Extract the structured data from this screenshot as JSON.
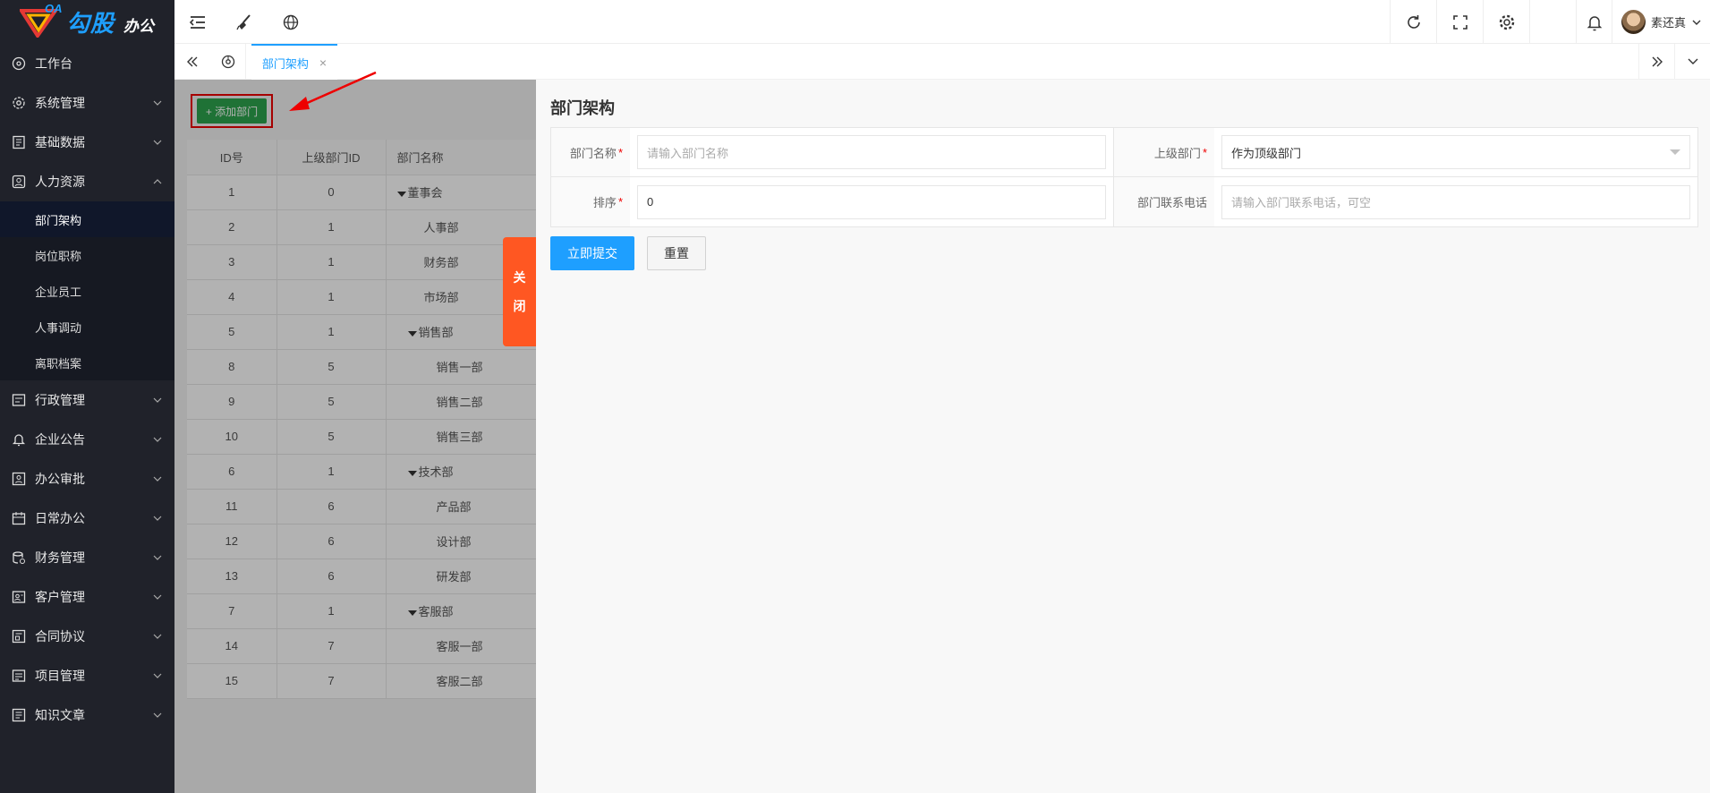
{
  "app": {
    "logo_oa": "OA",
    "logo_brand": "勾股",
    "logo_brand_sub": "办公"
  },
  "sidebar": {
    "items": [
      {
        "label": "工作台",
        "icon": "dashboard-icon"
      },
      {
        "label": "系统管理",
        "icon": "system-icon"
      },
      {
        "label": "基础数据",
        "icon": "data-icon"
      },
      {
        "label": "人力资源",
        "icon": "hr-icon"
      },
      {
        "label": "行政管理",
        "icon": "admin-icon"
      },
      {
        "label": "企业公告",
        "icon": "bell-icon"
      },
      {
        "label": "办公审批",
        "icon": "approve-icon"
      },
      {
        "label": "日常办公",
        "icon": "calendar-icon"
      },
      {
        "label": "财务管理",
        "icon": "finance-icon"
      },
      {
        "label": "客户管理",
        "icon": "customer-icon"
      },
      {
        "label": "合同协议",
        "icon": "contract-icon"
      },
      {
        "label": "项目管理",
        "icon": "project-icon"
      },
      {
        "label": "知识文章",
        "icon": "article-icon"
      }
    ],
    "hr_sub": [
      {
        "label": "部门架构"
      },
      {
        "label": "岗位职称"
      },
      {
        "label": "企业员工"
      },
      {
        "label": "人事调动"
      },
      {
        "label": "离职档案"
      }
    ]
  },
  "header": {
    "user_name": "素还真"
  },
  "tabs": {
    "active_label": "部门架构",
    "close": "×"
  },
  "page": {
    "add_button": "+ 添加部门",
    "table_headers": {
      "id": "ID号",
      "pid": "上级部门ID",
      "name": "部门名称"
    },
    "rows": [
      {
        "id": "1",
        "pid": "0",
        "name": "董事会",
        "level": 0,
        "tree": true
      },
      {
        "id": "2",
        "pid": "1",
        "name": "人事部",
        "level": 1,
        "tree": false
      },
      {
        "id": "3",
        "pid": "1",
        "name": "财务部",
        "level": 1,
        "tree": false
      },
      {
        "id": "4",
        "pid": "1",
        "name": "市场部",
        "level": 1,
        "tree": false
      },
      {
        "id": "5",
        "pid": "1",
        "name": "销售部",
        "level": 1,
        "tree": true
      },
      {
        "id": "8",
        "pid": "5",
        "name": "销售一部",
        "level": 2,
        "tree": false
      },
      {
        "id": "9",
        "pid": "5",
        "name": "销售二部",
        "level": 2,
        "tree": false
      },
      {
        "id": "10",
        "pid": "5",
        "name": "销售三部",
        "level": 2,
        "tree": false
      },
      {
        "id": "6",
        "pid": "1",
        "name": "技术部",
        "level": 1,
        "tree": true
      },
      {
        "id": "11",
        "pid": "6",
        "name": "产品部",
        "level": 2,
        "tree": false
      },
      {
        "id": "12",
        "pid": "6",
        "name": "设计部",
        "level": 2,
        "tree": false
      },
      {
        "id": "13",
        "pid": "6",
        "name": "研发部",
        "level": 2,
        "tree": false
      },
      {
        "id": "7",
        "pid": "1",
        "name": "客服部",
        "level": 1,
        "tree": true
      },
      {
        "id": "14",
        "pid": "7",
        "name": "客服一部",
        "level": 2,
        "tree": false
      },
      {
        "id": "15",
        "pid": "7",
        "name": "客服二部",
        "level": 2,
        "tree": false
      }
    ]
  },
  "drawer": {
    "close_chars": [
      "关",
      "闭"
    ],
    "title": "部门架构",
    "fields": {
      "name_label": "部门名称",
      "name_placeholder": "请输入部门名称",
      "parent_label": "上级部门",
      "parent_value": "作为顶级部门",
      "sort_label": "排序",
      "sort_value": "0",
      "phone_label": "部门联系电话",
      "phone_placeholder": "请输入部门联系电话，可空"
    },
    "submit": "立即提交",
    "reset": "重置"
  }
}
